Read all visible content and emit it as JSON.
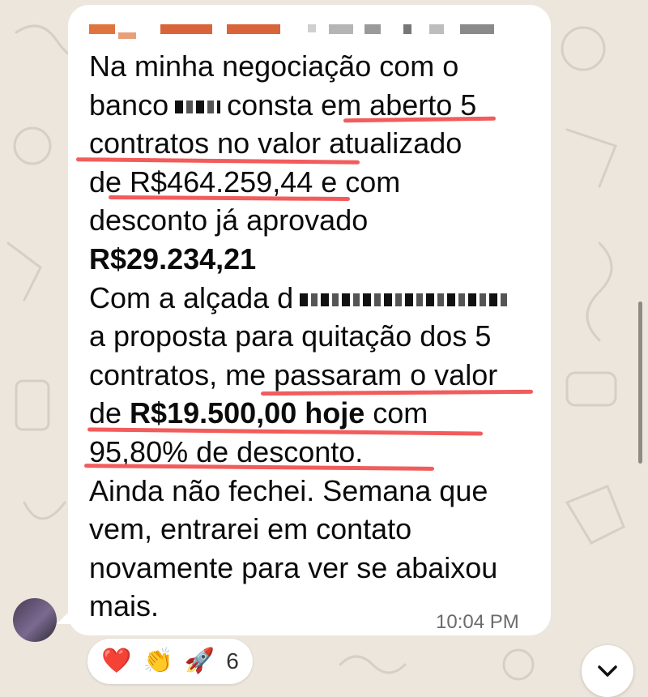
{
  "message": {
    "lines": [
      {
        "pre": "Na minha negociação com o"
      },
      {
        "pre": "banco",
        "post": "consta em aberto 5"
      },
      {
        "pre": "contratos no valor atualizado"
      },
      {
        "pre": "de R$464.259,44 e com"
      },
      {
        "pre": "desconto já aprovado"
      },
      {
        "bold": "R$29.234,21"
      },
      {
        "pre": "Com a alçada d"
      },
      {
        "pre": "a proposta para quitação dos 5"
      },
      {
        "pre": "contratos, me passaram o valor"
      },
      {
        "pre": "de ",
        "bold": "R$19.500,00 hoje",
        "post": " com"
      },
      {
        "pre": "95,80% de desconto."
      },
      {
        "pre": "Ainda não fechei. Semana que"
      },
      {
        "pre": "vem, entrarei em contato"
      },
      {
        "pre": "novamente para ver se abaixou"
      },
      {
        "pre": "mais."
      }
    ],
    "timestamp": "10:04 PM"
  },
  "reactions": {
    "emojis": [
      "❤️",
      "👏",
      "🚀"
    ],
    "count": "6"
  },
  "colors": {
    "bubble": "#ffffff",
    "underline": "#f25c5c",
    "sender_name": "#d9643a",
    "background": "#ece6dc"
  },
  "icons": {
    "scroll_down": "chevron-down-icon"
  }
}
